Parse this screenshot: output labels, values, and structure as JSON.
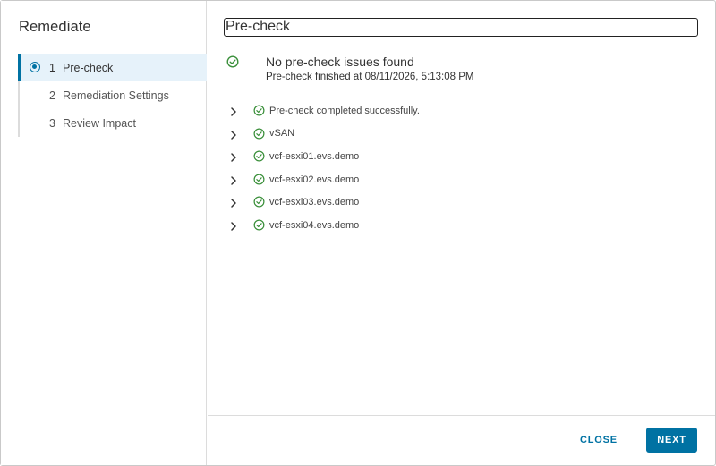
{
  "wizard": {
    "title": "Remediate",
    "steps": [
      {
        "number": "1",
        "label": "Pre-check",
        "active": true
      },
      {
        "number": "2",
        "label": "Remediation Settings",
        "active": false
      },
      {
        "number": "3",
        "label": "Review Impact",
        "active": false
      }
    ]
  },
  "main": {
    "title": "Pre-check",
    "summary": {
      "title": "No pre-check issues found",
      "subtitle": "Pre-check finished at 08/11/2026, 5:13:08 PM"
    },
    "results": [
      {
        "label": "Pre-check completed successfully."
      },
      {
        "label": "vSAN"
      },
      {
        "label": "vcf-esxi01.evs.demo"
      },
      {
        "label": "vcf-esxi02.evs.demo"
      },
      {
        "label": "vcf-esxi03.evs.demo"
      },
      {
        "label": "vcf-esxi04.evs.demo"
      }
    ]
  },
  "footer": {
    "close_label": "CLOSE",
    "next_label": "NEXT"
  },
  "colors": {
    "accent": "#0072a3",
    "success": "#3a8f3a",
    "active_step_bg": "#e6f2fa"
  },
  "icons": {
    "step_active": "radio-selected-icon",
    "status": "check-circle-icon",
    "expand": "chevron-right-icon"
  }
}
